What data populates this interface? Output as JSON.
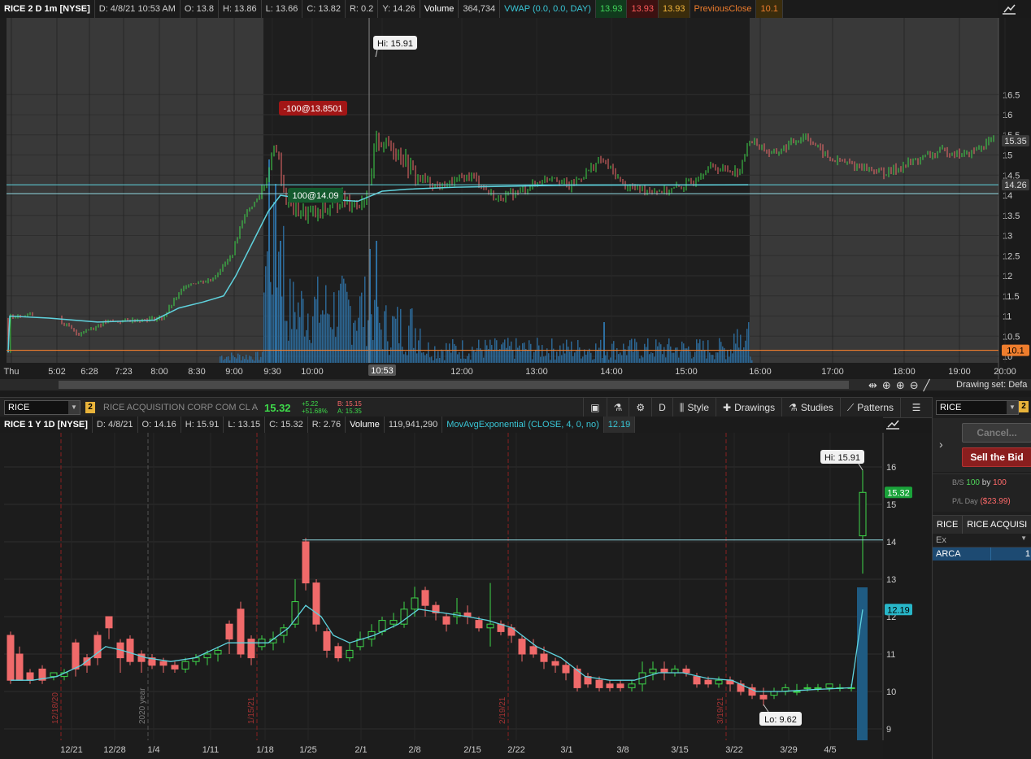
{
  "intraday": {
    "header": {
      "symbol": "RICE 2 D 1m [NYSE]",
      "date": "D: 4/8/21 10:53 AM",
      "open": "O: 13.8",
      "high": "H: 13.86",
      "low": "L: 13.66",
      "close": "C: 13.82",
      "range": "R: 0.2",
      "y": "Y: 14.26",
      "volume_label": "Volume",
      "volume_value": "364,734",
      "vwap_label": "VWAP (0.0, 0.0, DAY)",
      "vwap_v1": "13.93",
      "vwap_v2": "13.93",
      "vwap_v3": "13.93",
      "prevclose_label": "PreviousClose",
      "prevclose_value": "10.1"
    },
    "price_axis": [
      "16.5",
      "16",
      "15.5",
      "15",
      "14.5",
      "14",
      "13.5",
      "13",
      "12.5",
      "12",
      "11.5",
      "11",
      "10.5",
      "10"
    ],
    "price_tags": {
      "last": "15.35",
      "y": "14.26",
      "prev": "10.1"
    },
    "time_axis": [
      "Thu",
      "5:02",
      "6:28",
      "7:23",
      "8:00",
      "8:30",
      "9:00",
      "9:30",
      "10:00",
      "10:53",
      "12:00",
      "13:00",
      "14:00",
      "15:00",
      "16:00",
      "17:00",
      "18:00",
      "19:00",
      "20:00"
    ],
    "hi_label": "Hi: 15.91",
    "sell_label": "-100@13.8501",
    "buy_label": "100@14.09",
    "drawing_set": "Drawing set: Defa"
  },
  "toolbar": {
    "symbol": "RICE",
    "link": "2",
    "description": "RICE ACQUISITION CORP COM CL A",
    "last": "15.32",
    "change": "+5.22",
    "change_pct": "+51.68%",
    "bid": "B: 15.15",
    "ask": "A: 15.35",
    "aggregation": "D",
    "style": "Style",
    "drawings": "Drawings",
    "studies": "Studies",
    "patterns": "Patterns"
  },
  "daily": {
    "header": {
      "symbol": "RICE 1 Y 1D [NYSE]",
      "date": "D: 4/8/21",
      "open": "O: 14.16",
      "high": "H: 15.91",
      "low": "L: 13.15",
      "close": "C: 15.32",
      "range": "R: 2.76",
      "volume_label": "Volume",
      "volume_value": "119,941,290",
      "ema_label": "MovAvgExponential (CLOSE, 4, 0, no)",
      "ema_value": "12.19"
    },
    "price_axis": [
      "16",
      "15",
      "14",
      "13",
      "12",
      "11",
      "10",
      "9"
    ],
    "price_tags": {
      "last": "15.32",
      "ema": "12.19"
    },
    "date_axis": [
      "12/21",
      "12/28",
      "1/4",
      "1/11",
      "1/18",
      "1/25",
      "2/1",
      "2/8",
      "2/15",
      "2/22",
      "3/1",
      "3/8",
      "3/15",
      "3/22",
      "3/29",
      "4/5"
    ],
    "vlines": [
      "12/18/20",
      "2020 year",
      "1/15/21",
      "2/19/21",
      "3/19/21"
    ],
    "hi_label": "Hi: 15.91",
    "lo_label": "Lo: 9.62"
  },
  "right_panel": {
    "symbol": "RICE",
    "link": "2",
    "cancel": "Cancel...",
    "sell_bid": "Sell the Bid",
    "bs_label": "B/S",
    "bs_qty": "100",
    "bs_by": "by",
    "bs_qty2": "100",
    "pl_label": "P/L Day",
    "pl_value": "($23.99)",
    "tab_symbol": "RICE",
    "tab_desc": "RICE ACQUISI",
    "col_ex": "Ex",
    "row_ex": "ARCA",
    "row_val": "1"
  },
  "colors": {
    "up": "#3ed64a",
    "down": "#f06a6a",
    "vwap": "#5fd3de",
    "prevclose": "#ee7d2d",
    "volume": "#2d6ea0"
  }
}
